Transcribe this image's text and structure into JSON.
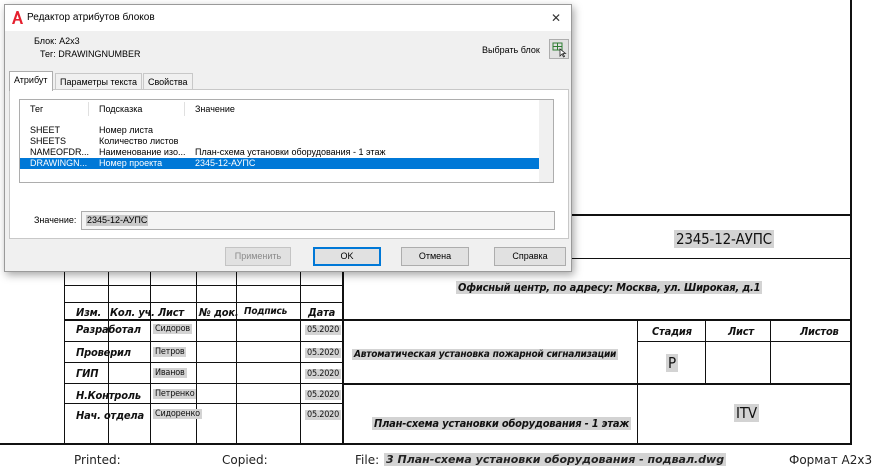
{
  "dialog": {
    "title": "Редактор атрибутов блоков",
    "close_symbol": "✕",
    "block_label": "Блок: A2x3",
    "tag_label": "Тег: DRAWINGNUMBER",
    "select_block_label": "Выбрать блок",
    "tabs": [
      {
        "label": "Атрибут",
        "active": true
      },
      {
        "label": "Параметры текста",
        "active": false
      },
      {
        "label": "Свойства",
        "active": false
      }
    ],
    "columns": {
      "tag": "Тег",
      "prompt": "Подсказка",
      "value": "Значение"
    },
    "rows": [
      {
        "tag": "SHEET",
        "prompt": "Номер листа",
        "value": "",
        "selected": false
      },
      {
        "tag": "SHEETS",
        "prompt": "Количество листов",
        "value": "",
        "selected": false
      },
      {
        "tag": "NAMEOFDR...",
        "prompt": "Наименование изо...",
        "value": "План-схема установки оборудования - 1 этаж",
        "selected": false
      },
      {
        "tag": "DRAWINGN...",
        "prompt": "Номер проекта",
        "value": "2345-12-АУПС",
        "selected": true
      }
    ],
    "value_label": "Значение:",
    "value_text": "2345-12-АУПС",
    "buttons": {
      "apply": "Применить",
      "ok": "OK",
      "cancel": "Отмена",
      "help": "Справка"
    },
    "icons": {
      "logo": "autocad-logo-icon",
      "select": "select-block-icon"
    },
    "accent_color": "#0078d7"
  },
  "drawing": {
    "project_number": "2345-12-АУПС",
    "address": "Офисный центр, по адресу: Москва, ул. Широкая, д.1",
    "headers": {
      "change": "Изм.",
      "count": "Кол. уч.",
      "sheet": "Лист",
      "doc": "№ док.",
      "sign": "Подпись",
      "date": "Дата"
    },
    "roles": [
      {
        "role": "Разработал",
        "name": "Сидоров",
        "date": "05.2020"
      },
      {
        "role": "Проверил",
        "name": "Петров",
        "date": "05.2020"
      },
      {
        "role": "ГИП",
        "name": "Иванов",
        "date": "05.2020"
      },
      {
        "role": "Н.Контроль",
        "name": "Петренко",
        "date": "05.2020"
      },
      {
        "role": "Нач. отдела",
        "name": "Сидоренко",
        "date": "05.2020"
      }
    ],
    "system_name": "Автоматическая установка пожарной сигнализации",
    "sheet_title": "План-схема установки оборудования - 1 этаж",
    "stage_header": "Стадия",
    "sheet_header": "Лист",
    "sheets_header": "Листов",
    "stage": "Р",
    "org": "ITV"
  },
  "footer": {
    "printed": "Printed:",
    "copied": "Copied:",
    "file_label": "File:",
    "file_name": "3 План-схема установки оборудования - подвал.dwg",
    "format": "Формат A2x3"
  }
}
